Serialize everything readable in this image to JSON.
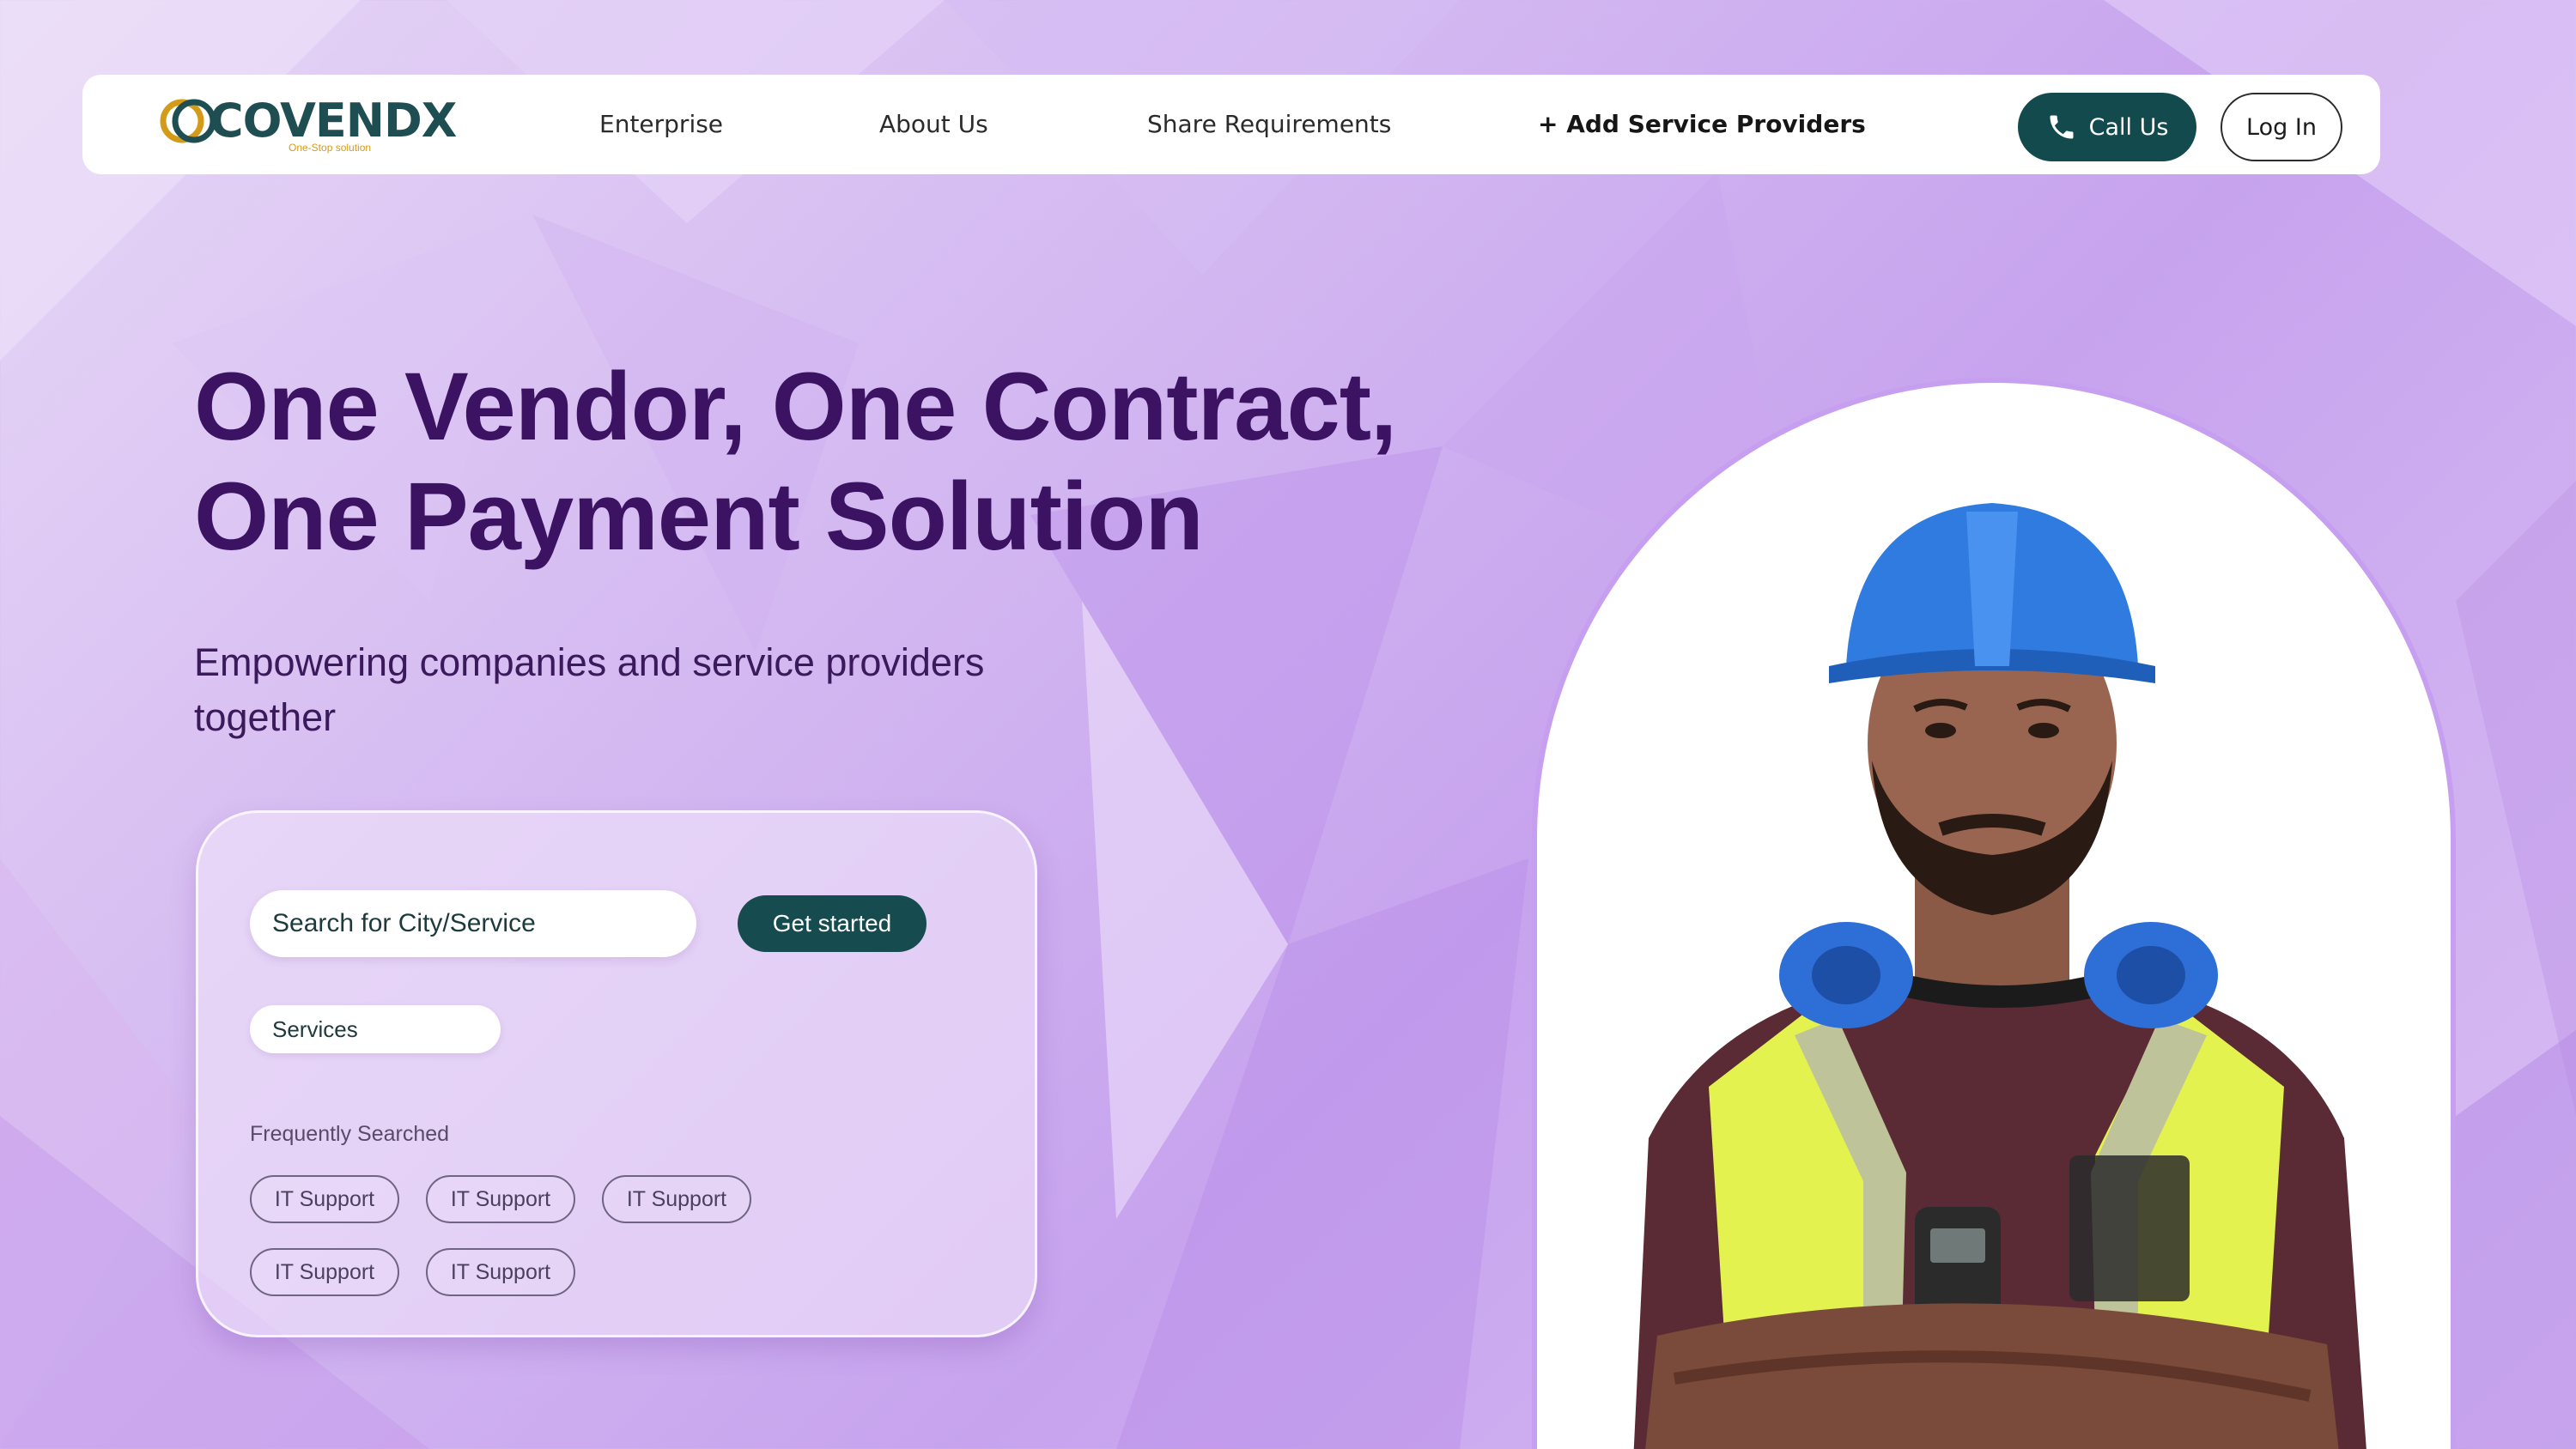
{
  "brand": {
    "name": "COVENDX",
    "tagline": "One-Stop solution"
  },
  "nav": {
    "links": [
      "Enterprise",
      "About Us",
      "Share Requirements",
      "+ Add Service Providers"
    ],
    "call_label": "Call Us",
    "login_label": "Log In"
  },
  "hero": {
    "title_line1": "One Vendor, One Contract,",
    "title_line2": "One Payment Solution",
    "subtitle": "Empowering companies and service providers together"
  },
  "search": {
    "placeholder": "Search for City/Service",
    "cta_label": "Get started",
    "category_select": "Services",
    "frequent_label": "Frequently Searched",
    "frequent_items": [
      "IT Support",
      "IT Support",
      "IT Support",
      "IT Support",
      "IT Support"
    ]
  },
  "icons": {
    "call": "phone-icon"
  },
  "colors": {
    "primary_dark_teal": "#134a4d",
    "heading_purple": "#3c1262",
    "background_purple": "#d3b8f1",
    "logo_teal": "#1e4e52",
    "logo_gold": "#d49b18",
    "arch_border": "#c69ff0"
  }
}
